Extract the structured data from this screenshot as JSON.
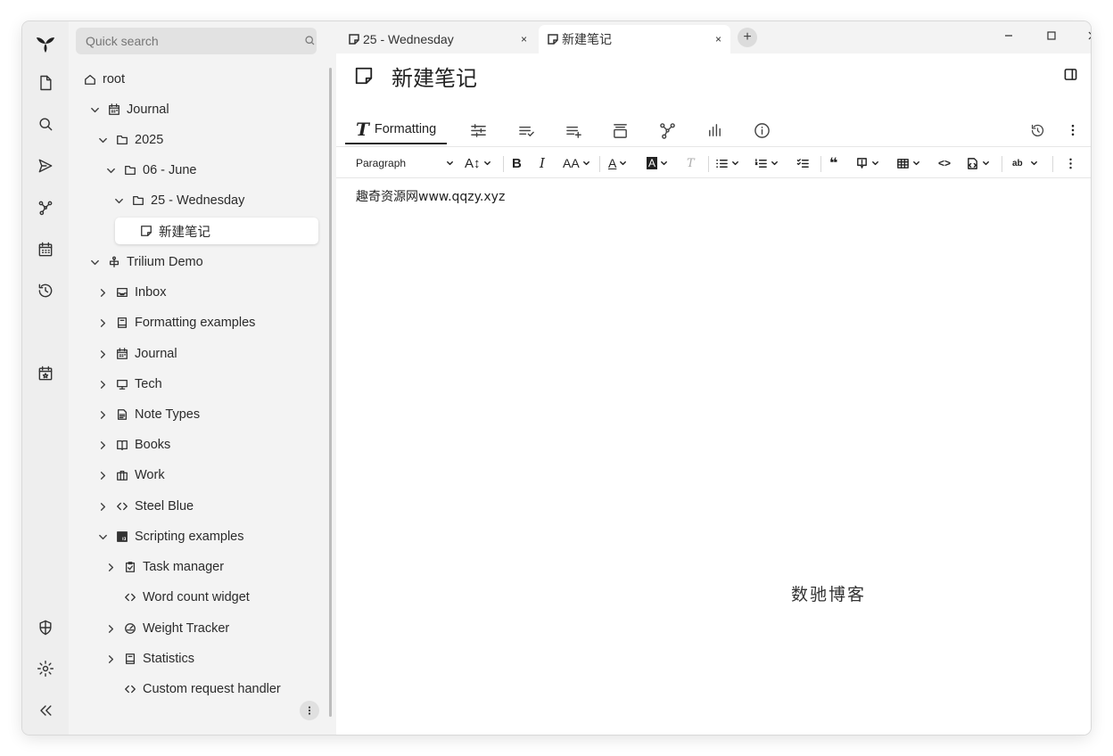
{
  "launcher": {
    "items": [
      "app-logo",
      "new-note",
      "search",
      "jump-to",
      "note-map",
      "calendar",
      "recent-changes",
      "today",
      "protected-session",
      "settings",
      "collapse"
    ]
  },
  "sidebar": {
    "search_placeholder": "Quick search",
    "tree": [
      {
        "label": "root",
        "icon": "home-icon"
      },
      {
        "label": "Journal",
        "icon": "calendar-icon"
      },
      {
        "label": "2025",
        "icon": "folder-icon"
      },
      {
        "label": "06 - June",
        "icon": "folder-icon"
      },
      {
        "label": "25 - Wednesday",
        "icon": "folder-icon"
      },
      {
        "label": "新建笔记",
        "icon": "note-icon"
      },
      {
        "label": "Trilium Demo",
        "icon": "anchor-icon"
      },
      {
        "label": "Inbox",
        "icon": "inbox-icon"
      },
      {
        "label": "Formatting examples",
        "icon": "book-icon"
      },
      {
        "label": "Journal",
        "icon": "calendar-icon"
      },
      {
        "label": "Tech",
        "icon": "monitor-icon"
      },
      {
        "label": "Note Types",
        "icon": "file-icon"
      },
      {
        "label": "Books",
        "icon": "open-book-icon"
      },
      {
        "label": "Work",
        "icon": "briefcase-icon"
      },
      {
        "label": "Steel Blue",
        "icon": "code-icon"
      },
      {
        "label": "Scripting examples",
        "icon": "js-icon"
      },
      {
        "label": "Task manager",
        "icon": "checkbox-icon"
      },
      {
        "label": "Word count widget",
        "icon": "code-icon"
      },
      {
        "label": "Weight Tracker",
        "icon": "gauge-icon"
      },
      {
        "label": "Statistics",
        "icon": "book-icon"
      },
      {
        "label": "Custom request handler",
        "icon": "code-icon"
      }
    ]
  },
  "tabs": [
    {
      "label": "25 - Wednesday",
      "close": "×"
    },
    {
      "label": "新建笔记",
      "close": "×"
    }
  ],
  "new_tab": "+",
  "note": {
    "title": "新建笔记",
    "ribbon_formatting_label": "Formatting",
    "ribbon_formatting_glyph": "T",
    "toolbar": {
      "paragraph": "Paragraph",
      "bold": "B",
      "italic": "I",
      "font_size": "AA",
      "heading_size": "A↕",
      "font_color": "A",
      "bg_color": "A",
      "remove_format": "T",
      "quote": "❝",
      "code": "<>",
      "ab": "ab"
    },
    "content": "趣奇资源网www.qqzy.xyz",
    "watermark": "数驰博客"
  }
}
